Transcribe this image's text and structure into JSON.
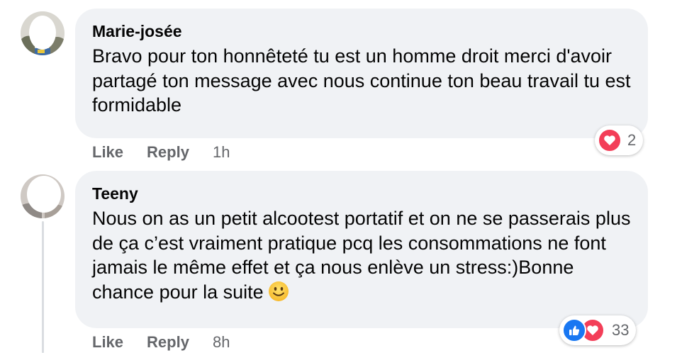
{
  "comments": [
    {
      "author": "Marie-josée",
      "text": "Bravo pour ton honnêteté tu est un homme droit merci d'avoir partagé ton message avec nous continue ton beau travail tu est formidable",
      "like_label": "Like",
      "reply_label": "Reply",
      "time": "1h",
      "reaction_count": "2",
      "reactions": [
        "love-icon"
      ]
    },
    {
      "author": "Teeny",
      "text": "Nous on as un petit alcootest portatif et on ne se passerais plus de ça c’est vraiment pratique pcq les consommations ne font jamais le même effet et ça nous enlève un stress:)Bonne chance pour la suite",
      "emoji": "slightly-smiling-face-icon",
      "like_label": "Like",
      "reply_label": "Reply",
      "time": "8h",
      "reaction_count": "33",
      "reactions": [
        "like-icon",
        "love-icon"
      ]
    }
  ],
  "colors": {
    "bubble": "#f0f2f5",
    "secondary_text": "#65676b",
    "love": "#f33e58",
    "like": "#1877f2"
  }
}
